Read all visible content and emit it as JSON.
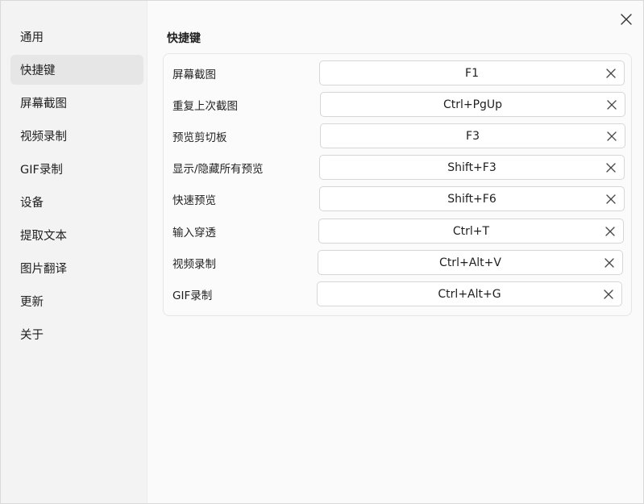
{
  "sidebar": {
    "items": [
      {
        "label": "通用",
        "active": false
      },
      {
        "label": "快捷键",
        "active": true
      },
      {
        "label": "屏幕截图",
        "active": false
      },
      {
        "label": "视频录制",
        "active": false
      },
      {
        "label": "GIF录制",
        "active": false
      },
      {
        "label": "设备",
        "active": false
      },
      {
        "label": "提取文本",
        "active": false
      },
      {
        "label": "图片翻译",
        "active": false
      },
      {
        "label": "更新",
        "active": false
      },
      {
        "label": "关于",
        "active": false
      }
    ]
  },
  "main": {
    "title": "快捷键",
    "shortcuts": [
      {
        "label": "屏幕截图",
        "value": "F1"
      },
      {
        "label": "重复上次截图",
        "value": "Ctrl+PgUp"
      },
      {
        "label": "预览剪切板",
        "value": "F3"
      },
      {
        "label": "显示/隐藏所有预览",
        "value": "Shift+F3"
      },
      {
        "label": "快速预览",
        "value": "Shift+F6"
      },
      {
        "label": "输入穿透",
        "value": "Ctrl+T"
      },
      {
        "label": "视频录制",
        "value": "Ctrl+Alt+V"
      },
      {
        "label": "GIF录制",
        "value": "Ctrl+Alt+G"
      }
    ]
  },
  "icons": {
    "close": "close-icon",
    "clear": "clear-icon"
  }
}
